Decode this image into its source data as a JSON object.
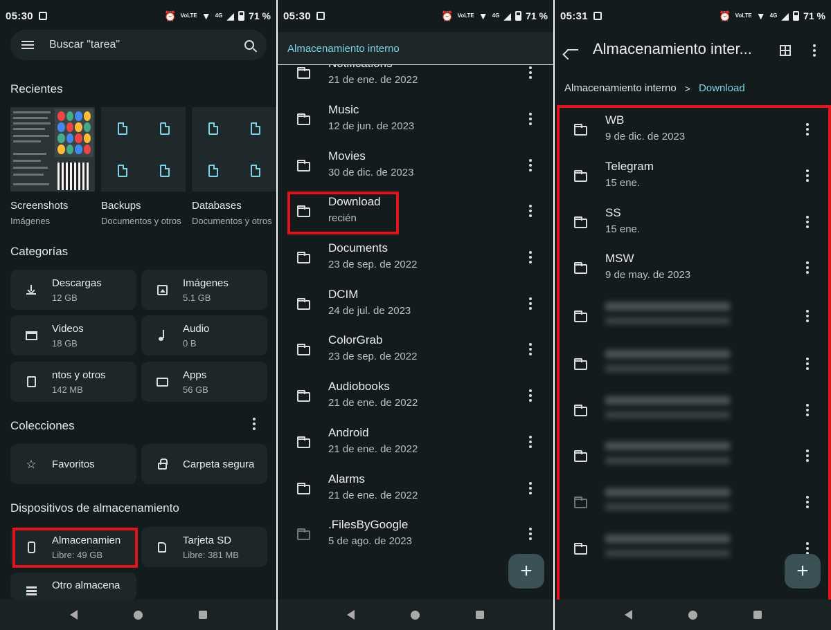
{
  "status": {
    "s1_time": "05:30",
    "s2_time": "05:30",
    "s3_time": "05:31",
    "volte": "VoLTE",
    "network": "4G",
    "battery": "71 %"
  },
  "screen1": {
    "search_placeholder": "Buscar \"tarea\"",
    "recents_title": "Recientes",
    "recents": [
      {
        "name": "Screenshots",
        "sub": "Imágenes"
      },
      {
        "name": "Backups",
        "sub": "Documentos y otros"
      },
      {
        "name": "Databases",
        "sub": "Documentos y otros"
      }
    ],
    "categories_title": "Categorías",
    "categories": [
      {
        "name": "Descargas",
        "size": "12 GB",
        "icon": "download-icon"
      },
      {
        "name": "Imágenes",
        "size": "5.1 GB",
        "icon": "image-icon"
      },
      {
        "name": "Videos",
        "size": "18 GB",
        "icon": "video-icon"
      },
      {
        "name": "Audio",
        "size": "0 B",
        "icon": "music-icon"
      },
      {
        "name": "ntos y otros",
        "size": "142 MB",
        "icon": "document-icon"
      },
      {
        "name": "Apps",
        "size": "56 GB",
        "icon": "apps-icon"
      }
    ],
    "collections_title": "Colecciones",
    "collections": [
      {
        "name": "Favoritos",
        "icon": "star-icon"
      },
      {
        "name": "Carpeta segura",
        "icon": "lock-icon"
      }
    ],
    "storage_title": "Dispositivos de almacenamiento",
    "storage": [
      {
        "name": "Almacenamien",
        "free": "Libre: 49 GB",
        "icon": "phone-icon"
      },
      {
        "name": "Tarjeta SD",
        "free": "Libre: 381 MB",
        "icon": "sd-card-icon"
      },
      {
        "name": "Otro almacena",
        "free": "",
        "icon": "list-icon"
      }
    ]
  },
  "screen2": {
    "header": "Almacenamiento interno",
    "folders": [
      {
        "name": "Notifications",
        "date": "21 de ene. de 2022"
      },
      {
        "name": "Music",
        "date": "12 de jun. de 2023"
      },
      {
        "name": "Movies",
        "date": "30 de dic. de 2023"
      },
      {
        "name": "Download",
        "date": "recién"
      },
      {
        "name": "Documents",
        "date": "23 de sep. de 2022"
      },
      {
        "name": "DCIM",
        "date": "24 de jul. de 2023"
      },
      {
        "name": "ColorGrab",
        "date": "23 de sep. de 2022"
      },
      {
        "name": "Audiobooks",
        "date": "21 de ene. de 2022"
      },
      {
        "name": "Android",
        "date": "21 de ene. de 2022"
      },
      {
        "name": "Alarms",
        "date": "21 de ene. de 2022"
      },
      {
        "name": ".FilesByGoogle",
        "date": "5 de ago. de 2023"
      }
    ],
    "fab": "+"
  },
  "screen3": {
    "title": "Almacenamiento inter...",
    "breadcrumb_root": "Almacenamiento interno",
    "breadcrumb_sep": ">",
    "breadcrumb_current": "Download",
    "folders": [
      {
        "name": "WB",
        "date": "9 de dic. de 2023"
      },
      {
        "name": "Telegram",
        "date": "15 ene."
      },
      {
        "name": "SS",
        "date": "15 ene."
      },
      {
        "name": "MSW",
        "date": "9 de may. de 2023"
      }
    ],
    "fab": "+"
  }
}
